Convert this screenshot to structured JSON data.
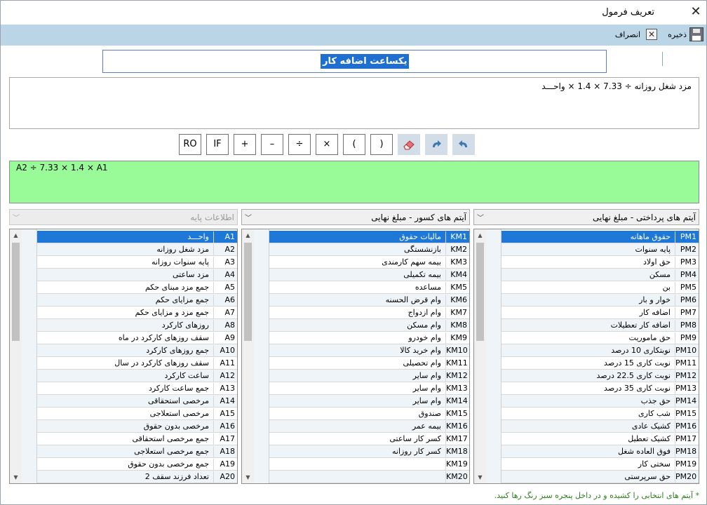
{
  "window": {
    "title": "تعریف فرمول",
    "close_glyph": "✕"
  },
  "toolbar": {
    "save_label": "ذخیره",
    "cancel_label": "انصراف"
  },
  "formula_title": "یکساعت اضافه کار",
  "formula_text": "مزد شغل روزانه ÷ 7.33 × 1.4 × واحـــد",
  "operators": [
    "RO",
    "IF",
    "+",
    "–",
    "÷",
    "×",
    "(",
    ")"
  ],
  "formula_code": "A2 ÷ 7.33 × 1.4 × A1",
  "panels": [
    {
      "header": "آیتم های پرداختی - مبلغ نهایی",
      "enabled": true,
      "items": [
        {
          "code": "PM1",
          "name": "حقوق ماهانه",
          "selected": true
        },
        {
          "code": "PM2",
          "name": "پایه سنوات"
        },
        {
          "code": "PM3",
          "name": "حق اولاد"
        },
        {
          "code": "PM4",
          "name": "مسکن"
        },
        {
          "code": "PM5",
          "name": "بن"
        },
        {
          "code": "PM6",
          "name": "خوار و بار"
        },
        {
          "code": "PM7",
          "name": "اضافه کار"
        },
        {
          "code": "PM8",
          "name": "اضافه کار تعطیلات"
        },
        {
          "code": "PM9",
          "name": "حق ماموریت"
        },
        {
          "code": "PM10",
          "name": "نوبتکاری 10 درصد"
        },
        {
          "code": "PM11",
          "name": "نوبت کاری 15 درصد"
        },
        {
          "code": "PM12",
          "name": "نوبت کاری 22.5 درصد"
        },
        {
          "code": "PM13",
          "name": "نوبت کاری 35 درصد"
        },
        {
          "code": "PM14",
          "name": "حق جذب"
        },
        {
          "code": "PM15",
          "name": "شب کاری"
        },
        {
          "code": "PM16",
          "name": "کشیک عادی"
        },
        {
          "code": "PM17",
          "name": "کشیک تعطیل"
        },
        {
          "code": "PM18",
          "name": "فوق العاده شغل"
        },
        {
          "code": "PM19",
          "name": "سختی کار"
        },
        {
          "code": "PM20",
          "name": "حق سرپرستی"
        }
      ]
    },
    {
      "header": "آیتم های کسور - مبلغ نهایی",
      "enabled": true,
      "items": [
        {
          "code": "KM1",
          "name": "مالیات حقوق",
          "selected": true
        },
        {
          "code": "KM2",
          "name": "بازنشستگی"
        },
        {
          "code": "KM3",
          "name": "بیمه سهم کارمندی"
        },
        {
          "code": "KM4",
          "name": "بیمه تکمیلی"
        },
        {
          "code": "KM5",
          "name": "مساعده"
        },
        {
          "code": "KM6",
          "name": "وام قرض الحسنه"
        },
        {
          "code": "KM7",
          "name": "وام ازدواج"
        },
        {
          "code": "KM8",
          "name": "وام مسکن"
        },
        {
          "code": "KM9",
          "name": "وام خودرو"
        },
        {
          "code": "KM10",
          "name": "وام خرید کالا"
        },
        {
          "code": "KM11",
          "name": "وام تحصیلی"
        },
        {
          "code": "KM12",
          "name": "وام سایر"
        },
        {
          "code": "KM13",
          "name": "وام سایر"
        },
        {
          "code": "KM14",
          "name": "وام سایر"
        },
        {
          "code": "KM15",
          "name": "صندوق"
        },
        {
          "code": "KM16",
          "name": "بیمه عمر"
        },
        {
          "code": "KM17",
          "name": "کسر کار ساعتی"
        },
        {
          "code": "KM18",
          "name": "کسر کار روزانه"
        },
        {
          "code": "KM19",
          "name": ""
        },
        {
          "code": "KM20",
          "name": ""
        }
      ]
    },
    {
      "header": "اطلاعات پایه",
      "enabled": false,
      "items": [
        {
          "code": "A1",
          "name": "واحـــد",
          "selected": true
        },
        {
          "code": "A2",
          "name": "مزد شغل روزانه"
        },
        {
          "code": "A3",
          "name": "پایه سنوات روزانه"
        },
        {
          "code": "A4",
          "name": "مزد ساعتی"
        },
        {
          "code": "A5",
          "name": "جمع مزد مبنای حکم"
        },
        {
          "code": "A6",
          "name": "جمع مزایای حکم"
        },
        {
          "code": "A7",
          "name": "جمع مزد و مزایای حکم"
        },
        {
          "code": "A8",
          "name": "روزهای کارکرد"
        },
        {
          "code": "A9",
          "name": "سقف روزهای کارکرد در ماه"
        },
        {
          "code": "A10",
          "name": "جمع روزهای کارکرد"
        },
        {
          "code": "A11",
          "name": "سقف روزهای کارکرد در سال"
        },
        {
          "code": "A12",
          "name": "ساعت کارکرد"
        },
        {
          "code": "A13",
          "name": "جمع ساعت کارکرد"
        },
        {
          "code": "A14",
          "name": "مرخصی استحقاقی"
        },
        {
          "code": "A15",
          "name": "مرخصی استعلاجی"
        },
        {
          "code": "A16",
          "name": "مرخصی بدون حقوق"
        },
        {
          "code": "A17",
          "name": "جمع مرخصی استحقاقی"
        },
        {
          "code": "A18",
          "name": "جمع مرخصی استعلاجی"
        },
        {
          "code": "A19",
          "name": "جمع مرخصی بدون حقوق"
        },
        {
          "code": "A20",
          "name": "تعداد فرزند سقف 2"
        }
      ]
    }
  ],
  "footer_note": "* آیتم های انتخابی را کشیده و در داخل پنجره سبز رنگ رها کنید."
}
